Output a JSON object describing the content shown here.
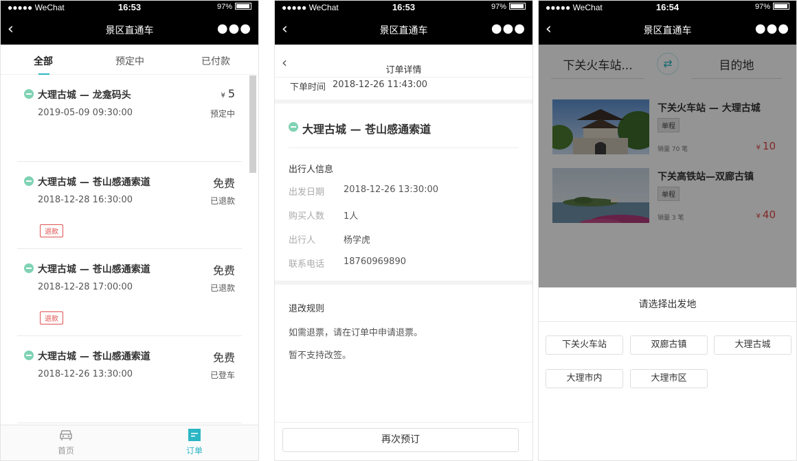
{
  "status_bar": [
    {
      "carrier": "●●●●● WeChat",
      "time": "16:53",
      "battery": "97%"
    },
    {
      "carrier": "●●●●● WeChat",
      "time": "16:53",
      "battery": "97%"
    },
    {
      "carrier": "●●●●● WeChat",
      "time": "16:54",
      "battery": "97%"
    }
  ],
  "app_title": "景区直通车",
  "orders_screen": {
    "tabs": [
      "全部",
      "预定中",
      "已付款"
    ],
    "active_tab": "全部",
    "orders": [
      {
        "route": "大理古城 — 龙龛码头",
        "datetime": "2019-05-09 09:30:00",
        "price_symbol": "¥",
        "price": "5",
        "status": "预定中",
        "refund_tag": ""
      },
      {
        "route": "大理古城 — 苍山感通索道",
        "datetime": "2018-12-28 16:30:00",
        "price_symbol": "",
        "price": "免费",
        "status": "已退款",
        "refund_tag": "退款"
      },
      {
        "route": "大理古城 — 苍山感通索道",
        "datetime": "2018-12-28 17:00:00",
        "price_symbol": "",
        "price": "免费",
        "status": "已退款",
        "refund_tag": "退款"
      },
      {
        "route": "大理古城 — 苍山感通索道",
        "datetime": "2018-12-26 13:30:00",
        "price_symbol": "",
        "price": "免费",
        "status": "已登车",
        "refund_tag": ""
      }
    ],
    "tabbar": [
      {
        "label": "首页",
        "icon": "car-icon",
        "active": false
      },
      {
        "label": "订单",
        "icon": "order-icon",
        "active": true
      }
    ]
  },
  "order_detail": {
    "title": "订单详情",
    "order_time_label": "下单时间",
    "order_time": "2018-12-26 11:43:00",
    "route": "大理古城 — 苍山感通索道",
    "traveler_section": "出行人信息",
    "fields": [
      {
        "label": "出发日期",
        "value": "2018-12-26 13:30:00"
      },
      {
        "label": "购买人数",
        "value": "1人"
      },
      {
        "label": "出行人",
        "value": "杨学虎"
      },
      {
        "label": "联系电话",
        "value": "18760969890"
      }
    ],
    "rules_title": "退改规则",
    "rules": [
      "如需退票，请在订单中申请退票。",
      "暂不支持改签。"
    ],
    "rebook_button": "再次预订"
  },
  "route_select": {
    "from": "下关火车站...",
    "to": "目的地",
    "routes": [
      {
        "name": "下关火车站 — 大理古城",
        "tag": "单程",
        "sales": "销量 70 笔",
        "price_symbol": "¥",
        "price": "10"
      },
      {
        "name": "下关高铁站—双廊古镇",
        "tag": "单程",
        "sales": "销量 3 笔",
        "price_symbol": "¥",
        "price": "40"
      }
    ],
    "sheet_title": "请选择出发地",
    "places": [
      "下关火车站",
      "双廊古镇",
      "大理古城",
      "大理市内",
      "大理市区"
    ]
  },
  "colors": {
    "accent": "#2bb6c4",
    "price_red": "#e04545",
    "status_black": "#000000",
    "route_dot": "#7fd3b3"
  }
}
